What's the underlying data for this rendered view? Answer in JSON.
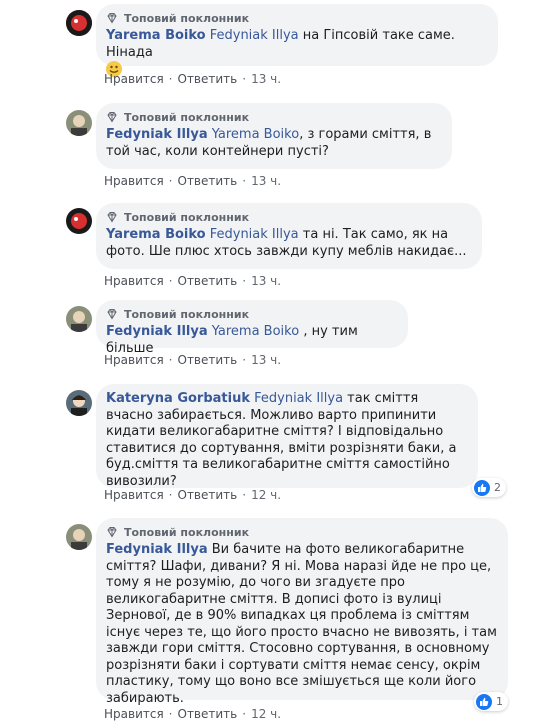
{
  "badge_label": "Топовий поклонник",
  "actions": {
    "like": "Нравится",
    "reply": "Ответить",
    "separator": "·"
  },
  "comments": [
    {
      "author": "Yarema Boiko",
      "mention": "Fedyniak Illya",
      "text": " на Гіпсовій таке саме. Нінада",
      "time": "13 ч."
    },
    {
      "author": "Fedyniak Illya",
      "mention": "Yarema Boiko",
      "text": ", з горами сміття, в той час, коли контейнери пусті?",
      "time": "13 ч."
    },
    {
      "author": "Yarema Boiko",
      "mention": "Fedyniak Illya",
      "text": " та ні. Так само, як на фото. Ше плюс хтось завжди купу меблів накидає...",
      "time": "13 ч."
    },
    {
      "author": "Fedyniak Illya",
      "mention": "Yarema Boiko",
      "text": " , ну тим більше",
      "time": "13 ч."
    },
    {
      "author": "Kateryna Gorbatiuk",
      "mention": "Fedyniak Illya",
      "text": " так сміття вчасно забирається. Можливо варто припинити кидати великогабаритне сміття? І відповідально ставитися до сортування, вміти розрізняти баки, а буд.сміття та великогабаритне сміття самостійно вивозили?",
      "time": "12 ч.",
      "reactions": "2"
    },
    {
      "author": "Fedyniak Illya",
      "mention": "",
      "text": " Ви бачите на фото великогабаритне сміття? Шафи, дивани? Я ні. Мова наразі йде не про це, тому я не розумію, до чого ви згадуєте про великогабаритне сміття. В дописі фото із вулиці Зернової, де в 90% випадках ця проблема із сміттям існує через те, що його просто вчасно не вивозять, і там завжди гори сміття. Стосовно сортування, в основному розрізняти баки і сортувати сміття немає сенсу, окрім пластику, тому що воно все змішується ще коли його забирають.",
      "time": "12 ч.",
      "reactions": "1"
    }
  ]
}
